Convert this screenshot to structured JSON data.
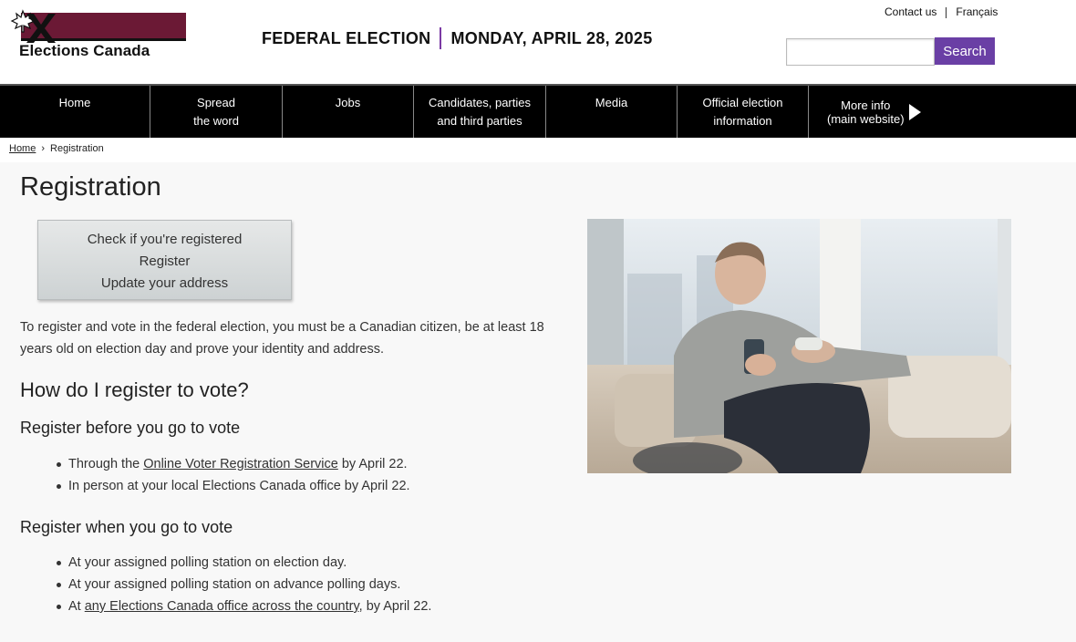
{
  "header": {
    "logo_text": "Elections Canada",
    "election_label": "FEDERAL ELECTION",
    "election_date": "MONDAY, APRIL 28, 2025",
    "contact_link": "Contact us",
    "language_link": "Français",
    "search": {
      "value": "",
      "button_label": "Search"
    },
    "colors": {
      "brand": "#6b1935",
      "accent": "#6a3fa5"
    }
  },
  "nav": {
    "items": [
      {
        "line1": "Home",
        "line2": ""
      },
      {
        "line1": "Spread",
        "line2": "the word"
      },
      {
        "line1": "Jobs",
        "line2": ""
      },
      {
        "line1": "Candidates, parties",
        "line2": "and third parties"
      },
      {
        "line1": "Media",
        "line2": ""
      },
      {
        "line1": "Official election",
        "line2": "information"
      }
    ],
    "more": {
      "line1": "More info",
      "line2": "(main website)",
      "icon": "triangle-right-icon"
    }
  },
  "breadcrumb": {
    "home": "Home",
    "sep": "›",
    "current": "Registration"
  },
  "main": {
    "title": "Registration",
    "actions": [
      "Check if you're registered",
      "Register",
      "Update your address"
    ],
    "intro": "To register and vote in the federal election, you must be a Canadian citizen, be at least 18 years old on election day and prove your identity and address.",
    "how_heading": "How do I register to vote?",
    "before": {
      "heading": "Register before you go to vote",
      "item1_pre": "Through the ",
      "item1_link": "Online Voter Registration Service",
      "item1_post": " by April 22.",
      "item2": "In person at your local Elections Canada office by April 22."
    },
    "when": {
      "heading": "Register when you go to vote",
      "item1": "At your assigned polling station on election day.",
      "item2": "At your assigned polling station on advance polling days.",
      "item3_pre": "At ",
      "item3_link": "any Elections Canada office across the country",
      "item3_post": ", by April 22."
    }
  }
}
